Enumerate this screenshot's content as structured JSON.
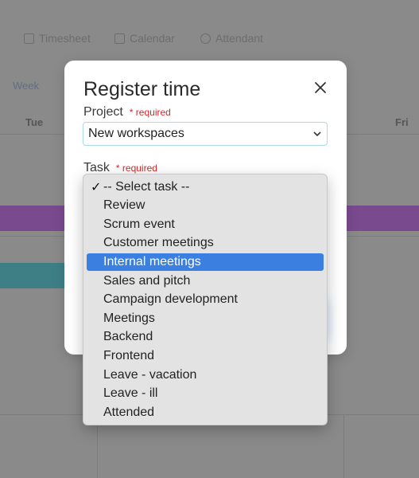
{
  "background": {
    "nav": [
      {
        "label": "Timesheet",
        "icon": "grid-icon"
      },
      {
        "label": "Calendar",
        "icon": "calendar-icon"
      },
      {
        "label": "Attendant",
        "icon": "clock-icon"
      }
    ],
    "week_label": "Week",
    "days": [
      "Tue",
      "Fri"
    ]
  },
  "modal": {
    "title": "Register time",
    "project": {
      "label": "Project",
      "required": "* required",
      "value": "New workspaces"
    },
    "task": {
      "label": "Task",
      "required": "* required"
    }
  },
  "dropdown": {
    "checked_index": 0,
    "highlighted_index": 4,
    "options": [
      "-- Select task --",
      "Review",
      "Scrum event",
      "Customer meetings",
      "Internal meetings",
      "Sales and pitch",
      "Campaign development",
      "Meetings",
      "Backend",
      "Frontend",
      "Leave - vacation",
      "Leave - ill",
      "Attended"
    ]
  },
  "colors": {
    "highlight": "#3b7fe0",
    "required": "#d12a2a",
    "select_border": "#a9dbe8"
  }
}
